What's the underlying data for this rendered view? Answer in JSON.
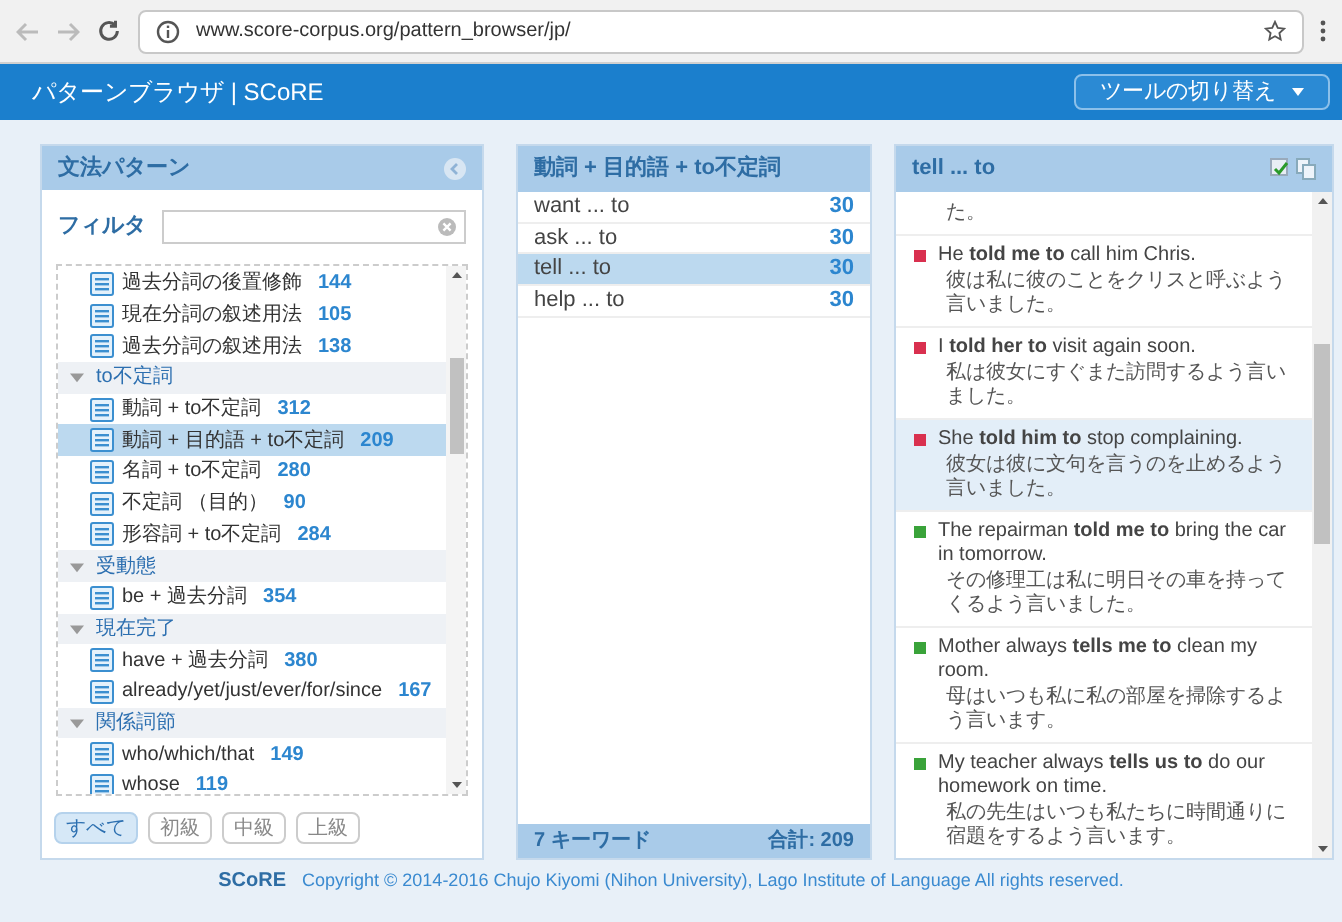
{
  "browser": {
    "url": "www.score-corpus.org/pattern_browser/jp/"
  },
  "header": {
    "title": "パターンブラウザ | SCoRE",
    "tool_button": "ツールの切り替え"
  },
  "patterns_panel": {
    "title": "文法パターン",
    "filter": {
      "label": "フィルタ"
    },
    "tree": [
      {
        "kind": "item",
        "label": "過去分詞の後置修飾",
        "count": "144",
        "selected": false
      },
      {
        "kind": "item",
        "label": "現在分詞の叙述用法",
        "count": "105",
        "selected": false
      },
      {
        "kind": "item",
        "label": "過去分詞の叙述用法",
        "count": "138",
        "selected": false
      },
      {
        "kind": "group",
        "label": "to不定詞",
        "expanded": true,
        "children": [
          {
            "kind": "item",
            "label": "動詞 + to不定詞",
            "count": "312",
            "selected": false
          },
          {
            "kind": "item",
            "label": "動詞 + 目的語 + to不定詞",
            "count": "209",
            "selected": true
          },
          {
            "kind": "item",
            "label": "名詞 + to不定詞",
            "count": "280",
            "selected": false
          },
          {
            "kind": "item",
            "label": "不定詞 （目的）",
            "count": "90",
            "selected": false
          },
          {
            "kind": "item",
            "label": "形容詞 + to不定詞",
            "count": "284",
            "selected": false
          }
        ]
      },
      {
        "kind": "group",
        "label": "受動態",
        "expanded": true,
        "children": [
          {
            "kind": "item",
            "label": "be + 過去分詞",
            "count": "354",
            "selected": false
          }
        ]
      },
      {
        "kind": "group",
        "label": "現在完了",
        "expanded": true,
        "children": [
          {
            "kind": "item",
            "label": "have + 過去分詞",
            "count": "380",
            "selected": false
          },
          {
            "kind": "item",
            "label": "already/yet/just/ever/for/since",
            "count": "167",
            "selected": false
          }
        ]
      },
      {
        "kind": "group",
        "label": "関係詞節",
        "expanded": true,
        "children": [
          {
            "kind": "item",
            "label": "who/which/that",
            "count": "149",
            "selected": false
          },
          {
            "kind": "item",
            "label": "whose",
            "count": "119",
            "selected": false
          }
        ]
      }
    ],
    "level_buttons": [
      {
        "label": "すべて",
        "selected": true
      },
      {
        "label": "初級",
        "selected": false
      },
      {
        "label": "中級",
        "selected": false
      },
      {
        "label": "上級",
        "selected": false
      }
    ]
  },
  "keywords_panel": {
    "title": "動詞 + 目的語 + to不定詞",
    "rows": [
      {
        "keyword": "want ... to",
        "count": "30",
        "selected": false
      },
      {
        "keyword": "ask ... to",
        "count": "30",
        "selected": false
      },
      {
        "keyword": "tell ... to",
        "count": "30",
        "selected": true
      },
      {
        "keyword": "help ... to",
        "count": "30",
        "selected": false
      }
    ],
    "footer_count": "7 キーワード",
    "footer_total": "合計: 209"
  },
  "examples_panel": {
    "title": "tell ... to",
    "examples": [
      {
        "japanese": "た。",
        "selected": false
      },
      {
        "color": "#d9304f",
        "english": "He **told me to** call him Chris.",
        "japanese": "彼は私に彼のことをクリスと呼ぶよう言いました。",
        "selected": false
      },
      {
        "color": "#d9304f",
        "english": "I **told her to** visit again soon.",
        "japanese": "私は彼女にすぐまた訪問するよう言いました。",
        "selected": false
      },
      {
        "color": "#d9304f",
        "english": "She **told him to** stop complaining.",
        "japanese": "彼女は彼に文句を言うのを止めるよう言いました。",
        "selected": true
      },
      {
        "color": "#3aa33a",
        "english": "The repairman **told me to** bring the car in tomorrow.",
        "japanese": "その修理工は私に明日その車を持ってくるよう言いました。",
        "selected": false
      },
      {
        "color": "#3aa33a",
        "english": "Mother always **tells me to** clean my room.",
        "japanese": "母はいつも私に私の部屋を掃除するよう言います。",
        "selected": false
      },
      {
        "color": "#3aa33a",
        "english": "My teacher always **tells us to** do our homework on time.",
        "japanese": "私の先生はいつも私たちに時間通りに宿題をするよう言います。",
        "selected": false
      }
    ]
  },
  "footer": {
    "brand": "SCoRE",
    "copyright": "Copyright © 2014-2016 Chujo Kiyomi (Nihon University), Lago Institute of Language All rights reserved."
  }
}
